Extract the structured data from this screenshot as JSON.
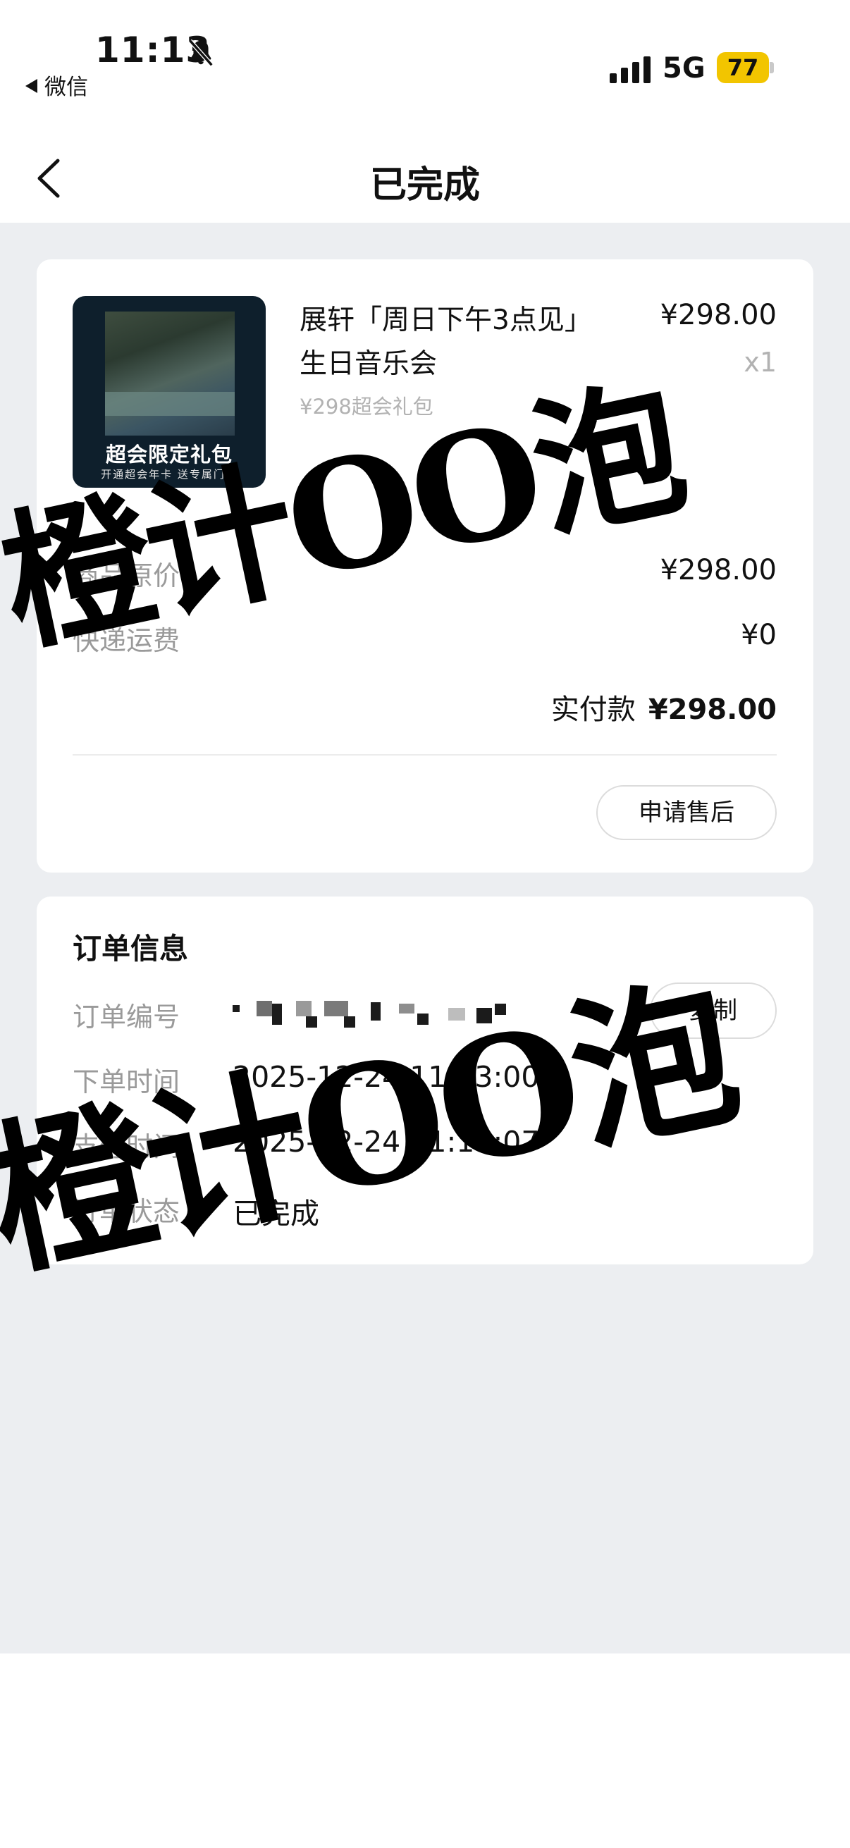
{
  "status_bar": {
    "time": "11:13",
    "back_app": "微信",
    "network": "5G",
    "battery": "77"
  },
  "nav": {
    "title": "已完成"
  },
  "product": {
    "image_title": "超会限定礼包",
    "image_subtitle": "开通超会年卡 送专属门票",
    "name": "展轩「周日下午3点见」生日音乐会",
    "sub": "¥298超会礼包",
    "price": "¥298.00",
    "qty": "x1"
  },
  "summary": {
    "original_price_label": "商品原价",
    "original_price": "¥298.00",
    "shipping_label": "快递运费",
    "shipping": "¥0",
    "paid_label": "实付款",
    "paid_amount": "¥298.00",
    "after_sale_button": "申请售后"
  },
  "order_info": {
    "title": "订单信息",
    "order_no_label": "订单编号",
    "copy_button": "复制",
    "order_time_label": "下单时间",
    "order_time": "2025-12-24 11:13:00",
    "pay_time_label": "支付时间",
    "pay_time": "2025-12-24 11:13:07",
    "status_label": "订单状态",
    "status": "已完成"
  },
  "watermark": {
    "text": "橙计OO泡"
  },
  "colors": {
    "background": "#eceef1",
    "battery": "#f2c500",
    "muted_text": "#9a9a9a"
  }
}
